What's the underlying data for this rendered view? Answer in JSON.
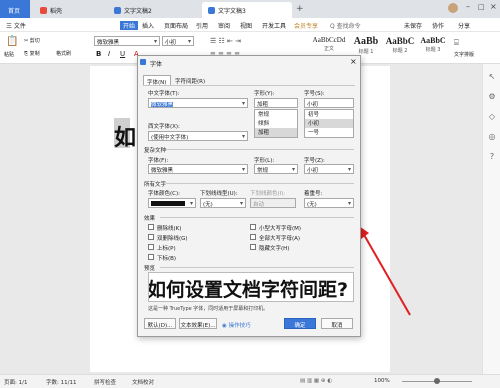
{
  "tabs": {
    "home": "首页",
    "t1": "稻壳",
    "t2": "文字文稿2",
    "t3": "文字文稿3"
  },
  "menu": {
    "file": "三 文件",
    "items": [
      "开始",
      "插入",
      "页面布局",
      "引用",
      "审阅",
      "视图",
      "开发工具",
      "会员专享"
    ],
    "search": "Q 查找命令",
    "right": [
      "未保存",
      "协作",
      "分享"
    ]
  },
  "ribbon": {
    "cut": "剪切",
    "copy": "复制",
    "paste": "粘贴",
    "format": "格式刷",
    "font": "微软雅黑",
    "size": "小初",
    "styles": [
      {
        "big": "AaBbCcDd",
        "cap": "正文"
      },
      {
        "big": "AaBb",
        "cap": "标题 1"
      },
      {
        "big": "AaBbC",
        "cap": "标题 2"
      },
      {
        "big": "AaBbC",
        "cap": "标题 3"
      }
    ],
    "findreplace": "文字排版",
    "textsel": "查找替换"
  },
  "doc": {
    "fragment": "如"
  },
  "status": {
    "page": "页面: 1/1",
    "words": "字数: 11/11",
    "spell": "拼写检查",
    "align": "文档校对",
    "zoom": "100%"
  },
  "dialog": {
    "title": "字体",
    "tab_font": "字体(N)",
    "tab_spacing": "字符间距(R)",
    "cn_font_label": "中文字体(T):",
    "cn_font_value": "微软雅黑",
    "style_label": "字形(Y):",
    "style_value": "加粗",
    "style_options": [
      "常规",
      "倾斜",
      "加粗"
    ],
    "size_label": "字号(S):",
    "size_value": "小初",
    "size_options": [
      "初号",
      "小初",
      "一号"
    ],
    "west_font_label": "西文字体(X):",
    "west_font_value": "(使用中文字体)",
    "complex_title": "复杂文种",
    "cx_font_label": "字体(F):",
    "cx_font_value": "微软雅黑",
    "cx_style_label": "字形(L):",
    "cx_style_value": "常规",
    "cx_size_label": "字号(Z):",
    "cx_size_value": "小初",
    "all_text_title": "所有文字",
    "color_label": "字体颜色(C):",
    "underline_label": "下划线线型(U):",
    "underline_value": "(无)",
    "underline_color_label": "下划线颜色(I):",
    "underline_color_value": "自动",
    "emph_label": "着重号:",
    "emph_value": "(无)",
    "effects_title": "效果",
    "effects_left": [
      "删除线(K)",
      "双删除线(G)",
      "上标(P)",
      "下标(B)"
    ],
    "effects_right": [
      "小型大写字母(M)",
      "全部大写字母(A)",
      "隐藏文字(H)"
    ],
    "preview_title": "预览",
    "preview_text": "如何设置文档字符间距?",
    "preview_note": "这是一种 TrueType 字体，同时适用于屏幕和打印机。",
    "btn_default": "默认(D)...",
    "btn_effect": "文本效果(E)...",
    "btn_tips": "操作技巧",
    "btn_ok": "确定",
    "btn_cancel": "取消"
  }
}
